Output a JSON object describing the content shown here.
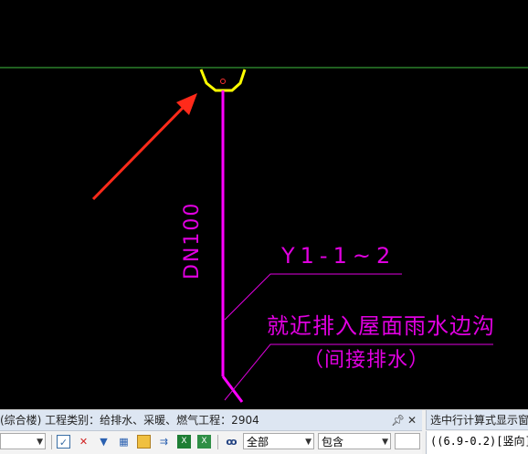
{
  "drawing": {
    "pipe_label": "DN100",
    "drain_id": "Y1-1~2",
    "note_line1": "就近排入屋面雨水边沟",
    "note_line2": "（间接排水）",
    "colors": {
      "background": "#000000",
      "axis_line": "#3fbf3f",
      "pipe": "#ff00ff",
      "annotation": "#e000e0",
      "drain_fitting": "#ffff00",
      "arrow": "#ff2a1a"
    }
  },
  "panel": {
    "header_text": "(综合楼)  工程类别：给排水、采暖、燃气工程：2904",
    "pin_icon": "pin-icon",
    "close_icon": "close-icon",
    "combo_left": "",
    "combo_scope": "全部",
    "combo_match": "包含",
    "icons": [
      "checkbox-icon",
      "delete-icon",
      "filter-icon",
      "table-icon",
      "export-icon",
      "excel-icon",
      "excel-export-icon",
      "binoculars-icon"
    ]
  },
  "side_panel": {
    "header_text": "选中行计算式显示窗",
    "formula_text": "((6.9-0.2)[竖向]"
  }
}
